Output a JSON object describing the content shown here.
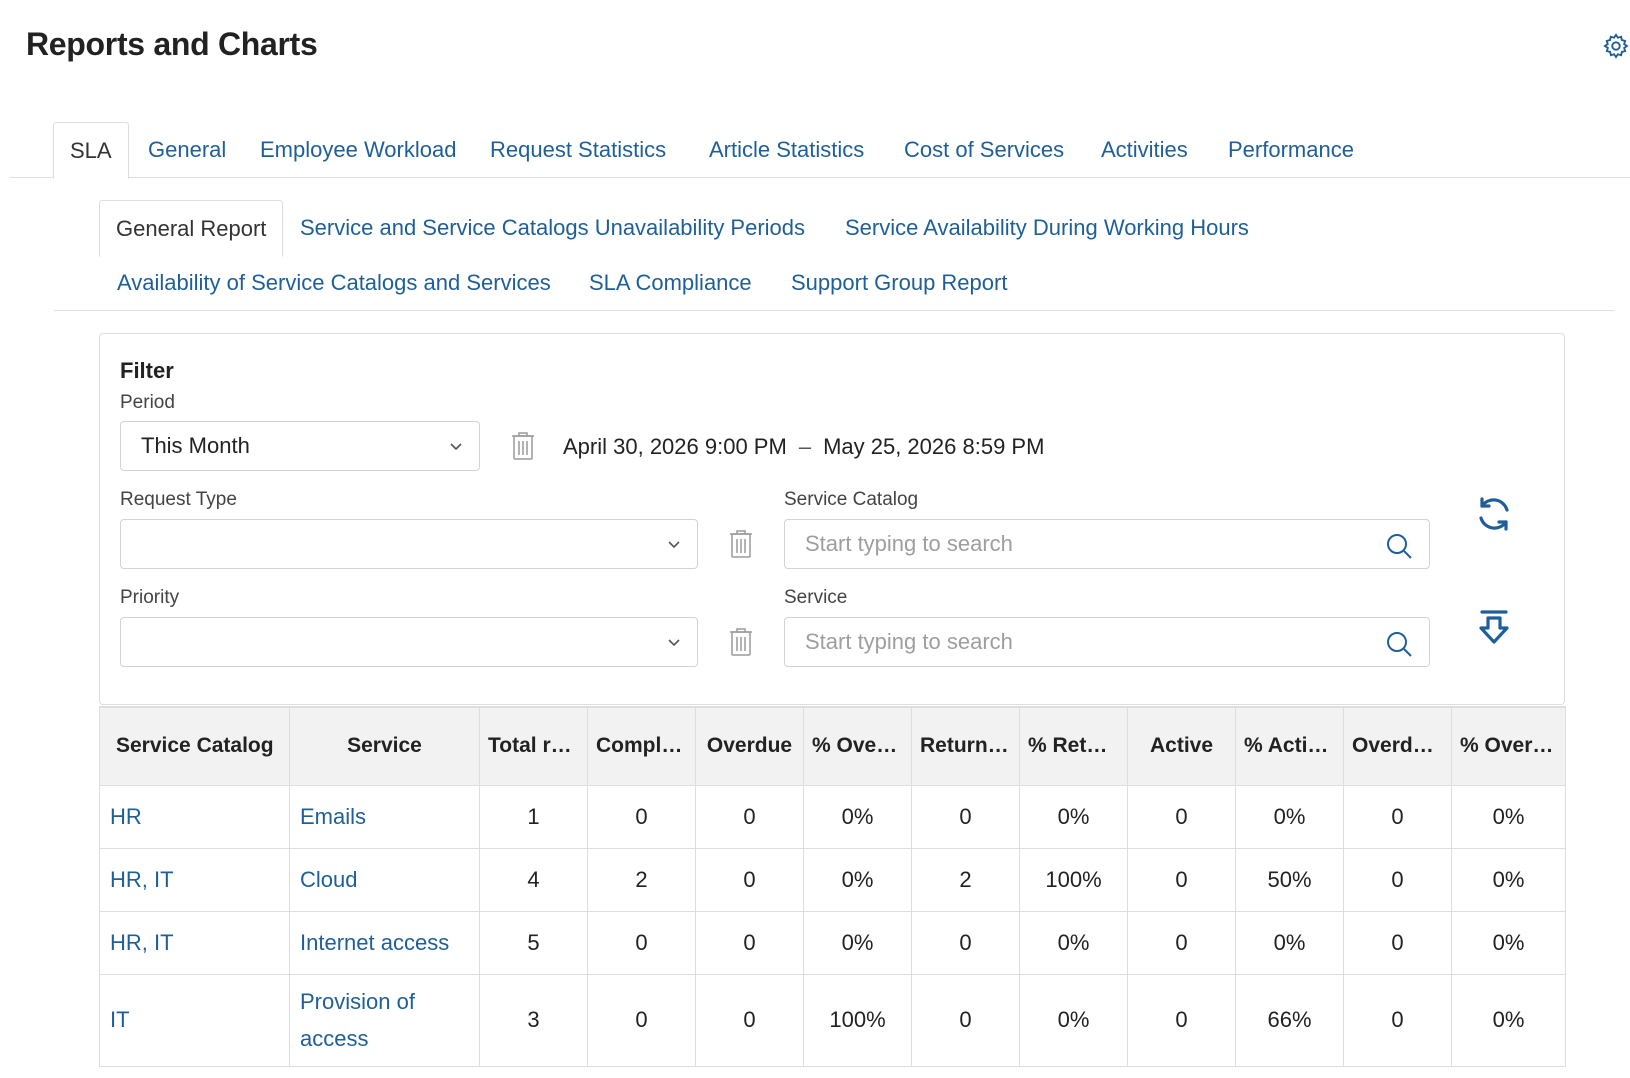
{
  "page": {
    "title": "Reports and Charts"
  },
  "icons": {
    "settings": "gear-icon",
    "trash": "trash-icon",
    "chevron": "chevron-down-icon",
    "search": "search-icon",
    "refresh": "refresh-icon",
    "export": "download-icon"
  },
  "colors": {
    "link": "#1f5f99",
    "border": "#dedede",
    "header_bg": "#f2f2f2"
  },
  "main_tabs": [
    {
      "label": "SLA",
      "active": true
    },
    {
      "label": "General",
      "active": false
    },
    {
      "label": "Employee Workload",
      "active": false
    },
    {
      "label": "Request Statistics",
      "active": false
    },
    {
      "label": "Article Statistics",
      "active": false
    },
    {
      "label": "Cost of Services",
      "active": false
    },
    {
      "label": "Activities",
      "active": false
    },
    {
      "label": "Performance",
      "active": false
    }
  ],
  "sub_tabs": [
    {
      "label": "General Report",
      "active": true
    },
    {
      "label": "Service and Service Catalogs Unavailability Periods",
      "active": false
    },
    {
      "label": "Service Availability During Working Hours",
      "active": false
    },
    {
      "label": "Availability of Service Catalogs and Services",
      "active": false
    },
    {
      "label": "SLA Compliance",
      "active": false
    },
    {
      "label": "Support Group Report",
      "active": false
    }
  ],
  "filter": {
    "title": "Filter",
    "period_label": "Period",
    "period_value": "This Month",
    "date_from": "April 30, 2026 9:00 PM",
    "date_separator": "–",
    "date_to": "May 25, 2026 8:59 PM",
    "request_type_label": "Request Type",
    "request_type_value": "",
    "priority_label": "Priority",
    "priority_value": "",
    "service_catalog_label": "Service Catalog",
    "service_catalog_placeholder": "Start typing to search",
    "service_label": "Service",
    "service_placeholder": "Start typing to search"
  },
  "table": {
    "columns": [
      "Service Catalog",
      "Service",
      "Total req...",
      "Complet...",
      "Overdue",
      "% Overd...",
      "Returned",
      "% Retur...",
      "Active",
      "% Active...",
      "Overdue...",
      "% Overd..."
    ],
    "rows": [
      {
        "catalog": "HR",
        "service": "Emails",
        "values": [
          "1",
          "0",
          "0",
          "0%",
          "0",
          "0%",
          "0",
          "0%",
          "0",
          "0%"
        ]
      },
      {
        "catalog": "HR, IT",
        "service": "Cloud",
        "values": [
          "4",
          "2",
          "0",
          "0%",
          "2",
          "100%",
          "0",
          "50%",
          "0",
          "0%"
        ]
      },
      {
        "catalog": "HR, IT",
        "service": "Internet access",
        "values": [
          "5",
          "0",
          "0",
          "0%",
          "0",
          "0%",
          "0",
          "0%",
          "0",
          "0%"
        ]
      },
      {
        "catalog": "IT",
        "service": "Provision of access",
        "values": [
          "3",
          "0",
          "0",
          "100%",
          "0",
          "0%",
          "0",
          "66%",
          "0",
          "0%"
        ]
      }
    ]
  }
}
